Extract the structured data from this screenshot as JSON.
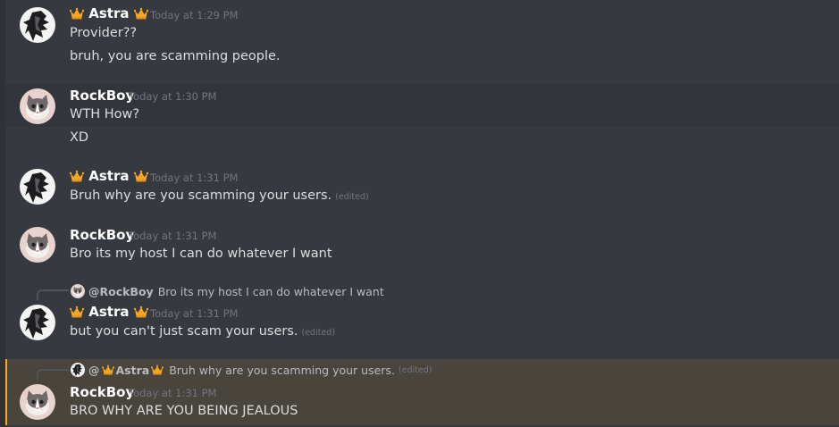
{
  "messages": [
    {
      "author": "Astra",
      "crowned": true,
      "timestamp": "Today at 1:29 PM",
      "lines": [
        "Provider??",
        "bruh, you are scamming people."
      ]
    },
    {
      "author": "RockBoy",
      "crowned": false,
      "timestamp": "Today at 1:30 PM",
      "lines": [
        "WTH How?",
        "XD"
      ]
    },
    {
      "author": "Astra",
      "crowned": true,
      "timestamp": "Today at 1:31 PM",
      "lines": [
        "Bruh why are you scamming your users."
      ],
      "edited": "(edited)"
    },
    {
      "author": "RockBoy",
      "crowned": false,
      "timestamp": "Today at 1:31 PM",
      "lines": [
        "Bro its my host I can do whatever I want"
      ]
    },
    {
      "author": "Astra",
      "crowned": true,
      "timestamp": "Today at 1:31 PM",
      "lines": [
        "but you can't just scam your users."
      ],
      "edited": "(edited)",
      "reply": {
        "author": "@RockBoy",
        "text": "Bro its my host I can do whatever I want"
      }
    },
    {
      "author": "RockBoy",
      "crowned": false,
      "timestamp": "Today at 1:31 PM",
      "lines": [
        "BRO WHY ARE YOU BEING JEALOUS"
      ],
      "reply": {
        "at": "@",
        "author": "Astra",
        "text": "Bruh why are you scamming your users.",
        "edited": "(edited)"
      }
    }
  ],
  "icons": {
    "crown": "crown-icon"
  },
  "colors": {
    "background": "#36393f",
    "hover": "#32353b",
    "mention_bg": "#49443c",
    "mention_bar": "#faa81a",
    "crown": "#f5a623"
  }
}
